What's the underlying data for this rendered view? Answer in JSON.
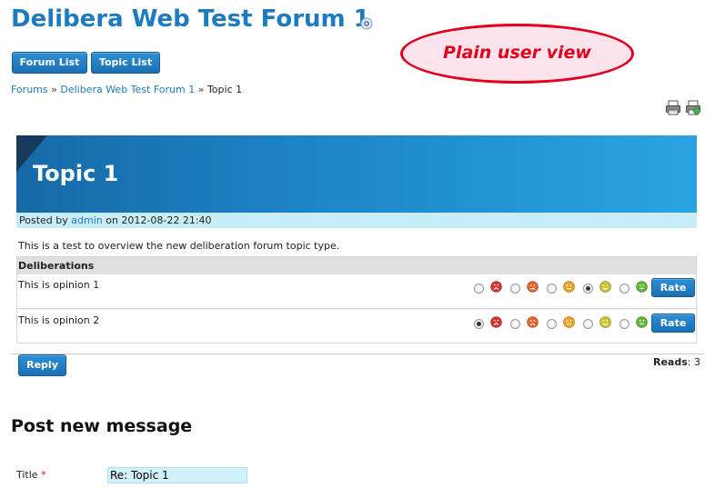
{
  "header": {
    "title": "Delibera Web Test Forum 1"
  },
  "toolbar": {
    "forum_list_label": "Forum List",
    "topic_list_label": "Topic List"
  },
  "annotation": {
    "text": "Plain user view",
    "color": "#e1001e"
  },
  "breadcrumb": {
    "items": [
      "Forums",
      "Delibera Web Test Forum 1",
      "Topic 1"
    ],
    "separator": "»"
  },
  "icons": {
    "title_icon": "rss-feed-icon",
    "tools": [
      "print-icon",
      "print-preview-icon"
    ]
  },
  "topic": {
    "title": "Topic 1",
    "posted_prefix": "Posted by",
    "author": "admin",
    "posted_on": "on 2012-08-22 21:40",
    "body": "This is a test to overview the new deliberation forum topic type."
  },
  "deliberations": {
    "header": "Deliberations",
    "rate_label": "Rate",
    "rating_faces": [
      "very-unhappy-face-icon",
      "unhappy-face-icon",
      "neutral-face-icon",
      "happy-face-icon",
      "very-happy-face-icon"
    ],
    "opinions": [
      {
        "text": "This is opinion 1",
        "selected_index": 3
      },
      {
        "text": "This is opinion 2",
        "selected_index": 0
      }
    ]
  },
  "thread_footer": {
    "reply_label": "Reply",
    "reads_label": "Reads",
    "reads_value": ": 3"
  },
  "post_form": {
    "heading": "Post new message",
    "title_label": "Title",
    "required_mark": "*",
    "title_value": "Re: Topic 1"
  },
  "colors": {
    "link": "#1d7bbf",
    "button": "#1b6fb3",
    "banner": "#1d86c8",
    "posted_bar": "#c7eef8"
  }
}
